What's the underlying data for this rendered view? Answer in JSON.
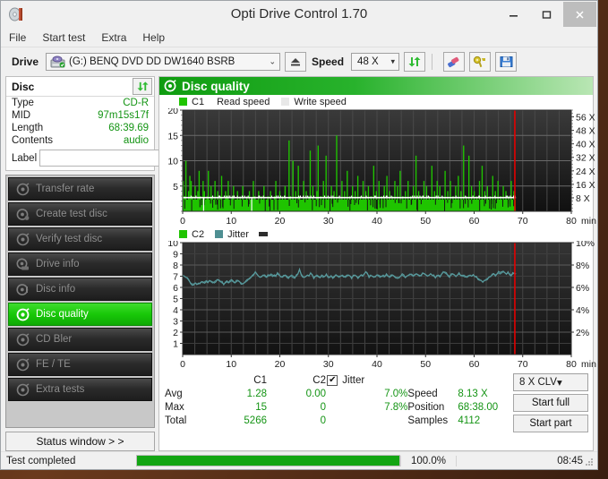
{
  "window": {
    "title": "Opti Drive Control 1.70",
    "app_icon": "disc-icon",
    "minimize": "–",
    "maximize": "□",
    "close": "✕"
  },
  "menu": [
    "File",
    "Start test",
    "Extra",
    "Help"
  ],
  "toolbar": {
    "drive_label": "Drive",
    "drive_value": "(G:)   BENQ DVD DD DW1640 BSRB",
    "eject_icon": "eject-icon",
    "speed_label": "Speed",
    "speed_value": "48 X",
    "refresh_icon": "refresh-icon",
    "erase_icon": "erase-icon",
    "tools_icon": "tools-icon",
    "save_icon": "save-icon",
    "caret": "⌄"
  },
  "disc": {
    "title": "Disc",
    "refresh_icon": "refresh-icon",
    "rows": [
      {
        "key": "Type",
        "value": "CD-R"
      },
      {
        "key": "MID",
        "value": "97m15s17f"
      },
      {
        "key": "Length",
        "value": "68:39.69"
      },
      {
        "key": "Contents",
        "value": "audio"
      }
    ],
    "label_key": "Label",
    "label_value": "",
    "label_placeholder": "",
    "label_button_icon": "cd-icon"
  },
  "nav": {
    "items": [
      {
        "label": "Transfer rate",
        "icon": "disc-rate-icon",
        "active": false
      },
      {
        "label": "Create test disc",
        "icon": "disc-burn-icon",
        "active": false
      },
      {
        "label": "Verify test disc",
        "icon": "disc-verify-icon",
        "active": false
      },
      {
        "label": "Drive info",
        "icon": "drive-info-icon",
        "active": false
      },
      {
        "label": "Disc info",
        "icon": "disc-info-icon",
        "active": false
      },
      {
        "label": "Disc quality",
        "icon": "disc-quality-icon",
        "active": true
      },
      {
        "label": "CD Bler",
        "icon": "disc-bler-icon",
        "active": false
      },
      {
        "label": "FE / TE",
        "icon": "disc-fete-icon",
        "active": false
      },
      {
        "label": "Extra tests",
        "icon": "disc-extra-icon",
        "active": false
      }
    ],
    "status_window": "Status window > >"
  },
  "panel": {
    "header": "Disc quality",
    "header_icon": "disc-quality-icon"
  },
  "stats": {
    "col_headers": [
      "",
      "C1",
      "C2"
    ],
    "rows": [
      {
        "name": "Avg",
        "c1": "1.28",
        "c2": "0.00",
        "jitter": "7.0%"
      },
      {
        "name": "Max",
        "c1": "15",
        "c2": "0",
        "jitter": "7.8%"
      },
      {
        "name": "Total",
        "c1": "5266",
        "c2": "0",
        "jitter": ""
      }
    ],
    "jitter_label": "Jitter",
    "jitter_checked": true,
    "jitter_check_glyph": "✔",
    "speed_key": "Speed",
    "speed_value": "8.13 X",
    "position_key": "Position",
    "position_value": "68:38.00",
    "samples_key": "Samples",
    "samples_value": "4112",
    "write_mode": "8 X CLV",
    "write_mode_caret": "⌄",
    "start_full": "Start full",
    "start_part": "Start part"
  },
  "statusbar": {
    "message": "Test completed",
    "percent_text": "100.0%",
    "percent_value": 100,
    "elapsed": "08:45"
  },
  "colors": {
    "accent_green": "#13a513",
    "value_green": "#149414",
    "c1_green": "#1fc400",
    "jitter_teal": "#4f8f92",
    "read_speed_white": "#ffffff",
    "marker_red": "#e50000",
    "plot_bg_dark": "#242424"
  },
  "chart_data": [
    {
      "type": "bar",
      "name": "c1-chart",
      "title": "",
      "legend": [
        {
          "label": "C1",
          "color": "#1fc400",
          "type": "bar"
        },
        {
          "label": "Read speed",
          "color": "#ffffff",
          "type": "line"
        },
        {
          "label": "Write speed",
          "color": "#e8e8e8",
          "type": "line"
        }
      ],
      "legend_position": "top-left",
      "grid": true,
      "xlabel": "min",
      "xlim": [
        0,
        80
      ],
      "xticks": [
        0,
        10,
        20,
        30,
        40,
        50,
        60,
        70,
        80
      ],
      "ylabel": "",
      "ylim": [
        0,
        20
      ],
      "yticks": [
        5,
        10,
        15,
        20
      ],
      "y2label": "",
      "y2lim": [
        0,
        60
      ],
      "y2ticks": [
        8,
        16,
        24,
        32,
        40,
        48,
        56
      ],
      "y2ticklabels": [
        "8 X",
        "16 X",
        "24 X",
        "32 X",
        "40 X",
        "48 X",
        "56 X"
      ],
      "data_end_x": 68.6,
      "marker_x": 68.38,
      "series": [
        {
          "name": "C1",
          "axis": "left",
          "values": [
            6,
            3,
            10,
            2,
            4,
            7,
            6,
            3,
            2,
            5,
            1,
            4,
            8,
            3,
            2,
            6,
            4,
            1,
            3,
            8,
            2,
            5,
            3,
            1,
            6,
            2,
            4,
            1,
            3,
            7,
            2,
            1,
            4,
            3,
            6,
            2,
            1,
            3,
            5,
            2,
            1,
            4,
            2,
            3,
            1,
            5,
            2,
            1,
            3,
            2,
            4,
            1,
            2,
            6,
            3,
            1,
            2,
            4,
            1,
            3,
            2,
            5,
            1,
            2,
            3,
            1,
            4,
            2,
            1,
            3,
            6,
            2,
            1,
            4,
            2,
            3,
            1,
            5,
            2,
            1,
            14,
            3,
            2,
            10,
            1,
            4,
            2,
            9,
            3,
            1,
            2,
            6,
            1,
            4,
            2,
            3,
            12,
            1,
            5,
            2,
            1,
            4,
            13,
            2,
            3,
            1,
            6,
            2,
            11,
            1,
            3,
            2,
            5,
            1,
            4,
            2,
            15,
            1,
            3,
            2,
            6,
            1,
            4,
            2,
            8,
            1,
            3,
            2,
            5,
            1,
            4,
            2,
            7,
            1,
            3,
            2,
            6,
            1,
            4,
            2,
            5,
            1,
            3,
            2,
            9,
            1,
            4,
            2,
            6,
            1,
            3,
            2,
            5,
            1,
            7,
            2,
            4,
            1,
            3,
            2,
            6,
            1,
            5,
            2,
            8,
            1,
            3,
            2,
            4,
            1,
            6,
            2,
            3,
            1,
            5,
            2,
            11,
            1,
            4,
            2,
            3,
            1,
            6,
            2,
            5,
            1,
            3,
            2,
            9,
            1,
            4,
            2,
            6,
            1,
            5,
            2,
            3,
            1,
            8,
            2,
            4,
            1,
            6,
            2,
            3,
            1,
            5,
            2,
            7,
            1,
            4,
            2,
            13,
            1,
            3,
            2,
            11,
            1,
            5,
            2,
            4,
            1,
            3,
            2,
            6,
            1,
            9,
            2,
            4,
            1,
            5,
            2,
            3,
            1,
            7,
            2,
            4,
            1,
            6,
            2,
            3,
            1,
            5,
            2,
            4,
            1,
            3,
            2,
            6,
            1,
            4,
            2
          ]
        },
        {
          "name": "Read speed",
          "axis": "right",
          "constant_value": 8.13,
          "values": [
            8.13
          ]
        }
      ]
    },
    {
      "type": "line",
      "name": "c2-jitter-chart",
      "title": "",
      "legend": [
        {
          "label": "C2",
          "color": "#1fc400",
          "type": "bar"
        },
        {
          "label": "Jitter",
          "color": "#4f8f92",
          "type": "line"
        }
      ],
      "legend_position": "top-left",
      "grid": true,
      "xlabel": "min",
      "xlim": [
        0,
        80
      ],
      "xticks": [
        0,
        10,
        20,
        30,
        40,
        50,
        60,
        70,
        80
      ],
      "ylabel": "",
      "ylim": [
        0,
        10
      ],
      "yticks": [
        1,
        2,
        3,
        4,
        5,
        6,
        7,
        8,
        9,
        10
      ],
      "y2label": "",
      "y2lim": [
        0,
        10
      ],
      "y2ticks": [
        2,
        4,
        6,
        8,
        10
      ],
      "y2ticklabels": [
        "2%",
        "4%",
        "6%",
        "8%",
        "10%"
      ],
      "data_end_x": 68.6,
      "marker_x": 68.38,
      "series": [
        {
          "name": "C2",
          "axis": "left",
          "values": []
        },
        {
          "name": "Jitter",
          "axis": "right",
          "values": [
            7.1,
            7.0,
            6.9,
            6.8,
            6.6,
            6.4,
            6.3,
            6.3,
            6.4,
            6.3,
            6.3,
            6.4,
            6.5,
            6.4,
            6.5,
            6.6,
            6.5,
            6.6,
            6.5,
            6.4,
            6.5,
            6.6,
            6.7,
            6.6,
            6.5,
            6.4,
            6.3,
            6.4,
            6.5,
            6.4,
            6.5,
            6.6,
            6.5,
            6.4,
            6.5,
            6.6,
            6.5,
            6.4,
            6.3,
            6.4,
            6.5,
            6.6,
            6.8,
            6.9,
            7.0,
            7.1,
            7.4,
            7.2,
            7.0,
            6.9,
            7.0,
            7.1,
            7.0,
            6.9,
            7.0,
            7.1,
            7.2,
            7.1,
            7.0,
            7.1,
            7.2,
            7.1,
            7.0,
            6.9,
            7.0,
            7.1,
            7.0,
            6.9,
            7.0,
            7.1,
            7.0,
            6.9,
            7.0,
            7.2,
            7.6,
            7.2,
            7.0,
            6.9,
            7.0,
            7.1,
            7.0,
            7.3,
            7.1,
            6.9,
            7.0,
            7.1,
            7.0,
            6.9,
            7.0,
            6.9,
            7.0,
            7.1,
            7.0,
            6.9,
            7.0,
            6.9,
            7.0,
            7.1,
            7.0,
            6.9,
            7.0,
            7.1,
            7.0,
            6.9,
            7.0,
            7.1,
            7.0,
            6.9,
            7.0,
            7.1,
            7.0,
            6.9,
            7.0,
            7.1,
            7.0,
            7.2,
            7.4,
            7.2,
            7.0,
            7.1,
            7.0,
            6.9,
            7.0,
            7.1,
            7.0,
            6.9,
            7.0,
            7.1,
            7.0,
            7.1,
            7.0,
            6.9,
            7.0,
            7.1,
            7.0,
            6.9,
            6.8,
            6.9,
            7.0,
            7.1,
            7.0,
            6.9,
            7.0,
            7.1,
            7.2,
            7.1,
            7.0,
            7.1,
            7.2,
            7.1,
            7.0,
            7.1,
            7.3,
            7.2,
            7.1,
            7.0,
            7.1,
            7.2,
            7.1,
            7.0,
            6.9,
            7.0,
            7.1,
            7.0,
            7.2,
            7.4,
            7.3,
            7.2,
            7.1,
            7.0,
            7.1,
            7.2,
            7.1,
            7.0,
            7.1,
            7.2,
            7.1,
            7.0,
            7.1,
            7.0,
            6.9,
            7.0,
            7.1,
            7.0,
            7.1,
            7.0,
            6.9,
            6.8,
            6.7,
            6.6,
            6.5,
            6.6,
            6.7,
            6.8,
            6.9,
            7.0,
            7.1,
            7.2,
            7.1,
            7.2,
            7.3,
            7.2,
            7.3,
            7.4,
            7.3,
            7.2,
            7.3,
            7.2,
            7.1,
            7.2,
            7.3,
            7.2
          ]
        }
      ]
    }
  ]
}
